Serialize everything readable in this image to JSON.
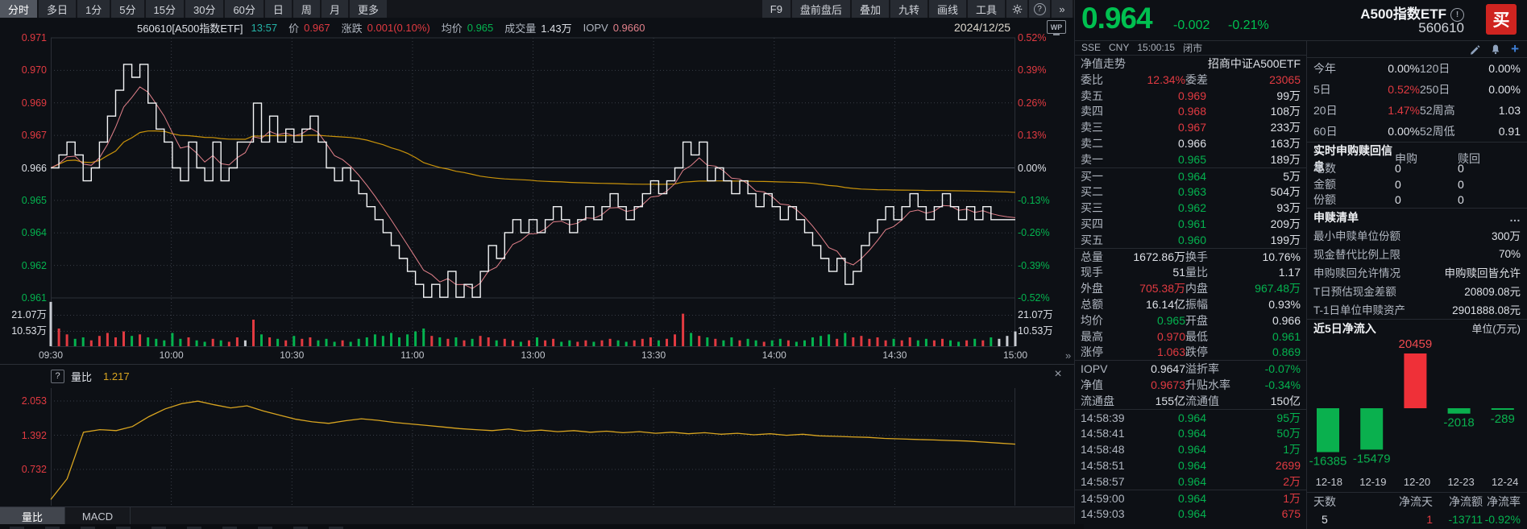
{
  "colors": {
    "up_red": "#e13a41",
    "down_green": "#04b34f",
    "flat_white": "#c9ccd3",
    "avg_yellow": "#c9930a",
    "price_line": "#f4f5f7",
    "iopv_pink": "#e2808a",
    "big_green": "#00c050",
    "buy_bg": "#cf2420"
  },
  "toolbar": {
    "periods": [
      "分时",
      "多日",
      "1分",
      "5分",
      "15分",
      "30分",
      "60分",
      "日",
      "周",
      "月",
      "更多"
    ],
    "active_period": "分时",
    "right_items": [
      "F9",
      "盘前盘后",
      "叠加",
      "九转",
      "画线",
      "工具"
    ],
    "help_icon": "?",
    "expand_icon": "»"
  },
  "info_bar": {
    "code_name": "560610[A500指数ETF]",
    "time": "13:57",
    "price_label": "价",
    "price": "0.967",
    "change_label": "涨跌",
    "change": "0.001(0.10%)",
    "avg_label": "均价",
    "avg": "0.965",
    "volume_label": "成交量",
    "volume": "1.43万",
    "iopv_label": "IOPV",
    "iopv": "0.9660",
    "date": "2024/12/25",
    "wp_badge": "WP"
  },
  "quote_header": {
    "price": "0.964",
    "change": "-0.002",
    "change_pct": "-0.21%",
    "name": "A500指数ETF",
    "code": "560610",
    "buy_button": "买",
    "info_mark": "!"
  },
  "sse_row": {
    "exchange": "SSE",
    "currency": "CNY",
    "time": "15:00:15",
    "status": "闭市"
  },
  "nav_row": {
    "label": "净值走势",
    "value": "招商中证A500ETF"
  },
  "weibi_row": {
    "label1": "委比",
    "value1": "12.34%",
    "label2": "委差",
    "value2": "23065"
  },
  "order_book": {
    "asks": [
      [
        "卖五",
        "0.969",
        "red",
        "99万"
      ],
      [
        "卖四",
        "0.968",
        "red",
        "108万"
      ],
      [
        "卖三",
        "0.967",
        "red",
        "233万"
      ],
      [
        "卖二",
        "0.966",
        "white",
        "163万"
      ],
      [
        "卖一",
        "0.965",
        "green",
        "189万"
      ]
    ],
    "bids": [
      [
        "买一",
        "0.964",
        "green",
        "5万"
      ],
      [
        "买二",
        "0.963",
        "green",
        "504万"
      ],
      [
        "买三",
        "0.962",
        "green",
        "93万"
      ],
      [
        "买四",
        "0.961",
        "green",
        "209万"
      ],
      [
        "买五",
        "0.960",
        "green",
        "199万"
      ]
    ]
  },
  "stats": [
    [
      "总量",
      "1672.86万",
      "white",
      "换手",
      "10.76%",
      "white"
    ],
    [
      "现手",
      "51",
      "white",
      "量比",
      "1.17",
      "white"
    ],
    [
      "外盘",
      "705.38万",
      "red",
      "内盘",
      "967.48万",
      "green"
    ],
    [
      "总额",
      "16.14亿",
      "white",
      "振幅",
      "0.93%",
      "white"
    ],
    [
      "均价",
      "0.965",
      "green",
      "开盘",
      "0.966",
      "white"
    ],
    [
      "最高",
      "0.970",
      "red",
      "最低",
      "0.961",
      "green"
    ],
    [
      "涨停",
      "1.063",
      "red",
      "跌停",
      "0.869",
      "green"
    ]
  ],
  "stats2": [
    [
      "IOPV",
      "0.9647",
      "white",
      "溢折率",
      "-0.07%",
      "green"
    ],
    [
      "净值",
      "0.9673",
      "red",
      "升贴水率",
      "-0.34%",
      "green"
    ],
    [
      "流通盘",
      "155亿",
      "white",
      "流通值",
      "150亿",
      "white"
    ]
  ],
  "ticks": [
    [
      "14:58:39",
      "0.964",
      "95万",
      "green"
    ],
    [
      "14:58:41",
      "0.964",
      "50万",
      "green"
    ],
    [
      "14:58:48",
      "0.964",
      "1万",
      "green"
    ],
    [
      "14:58:51",
      "0.964",
      "2699",
      "red"
    ],
    [
      "14:58:57",
      "0.964",
      "2万",
      "red"
    ],
    [
      "14:59:00",
      "0.964",
      "1万",
      "red"
    ],
    [
      "14:59:03",
      "0.964",
      "675",
      "red"
    ]
  ],
  "performance": [
    [
      "今年",
      "0.00%",
      "white",
      "120日",
      "0.00%",
      "white"
    ],
    [
      "5日",
      "0.52%",
      "red",
      "250日",
      "0.00%",
      "white"
    ],
    [
      "20日",
      "1.47%",
      "red",
      "52周高",
      "1.03",
      "white"
    ],
    [
      "60日",
      "0.00%",
      "white",
      "52周低",
      "0.91",
      "white"
    ]
  ],
  "realtime_section": {
    "title": "实时申购赎回信息",
    "col1": "申购",
    "col2": "赎回",
    "rows": [
      [
        "笔数",
        "0",
        "0"
      ],
      [
        "金额",
        "0",
        "0"
      ],
      [
        "份额",
        "0",
        "0"
      ]
    ]
  },
  "shenshu_section": {
    "title": "申赎清单",
    "more": "…",
    "rows": [
      [
        "最小申赎单位份额",
        "300万"
      ],
      [
        "现金替代比例上限",
        "70%"
      ],
      [
        "申购赎回允许情况",
        "申购赎回皆允许"
      ],
      [
        "T日预估现金差额",
        "20809.08元"
      ],
      [
        "T-1日单位申赎资产",
        "2901888.08元"
      ]
    ]
  },
  "netflow_footer": {
    "headers": [
      "天数",
      "净流天",
      "净流额",
      "净流率"
    ],
    "values": [
      "5",
      "1",
      "-13711",
      "-0.92%"
    ],
    "value_colors": [
      "white",
      "red",
      "green",
      "green"
    ]
  },
  "subchart_legend": {
    "help": "?",
    "name": "量比",
    "value": "1.217"
  },
  "subchart_tabs": [
    "量比",
    "MACD"
  ],
  "active_subchart_tab": "量比",
  "close_icon": "×",
  "divider_handle": "»",
  "chart_data": [
    {
      "type": "line",
      "name": "分时走势",
      "x_ticks": [
        "09:30",
        "10:00",
        "10:30",
        "11:00",
        "13:00",
        "13:30",
        "14:00",
        "14:30",
        "15:00"
      ],
      "x_tick_fractions": [
        0,
        0.125,
        0.25,
        0.375,
        0.5,
        0.625,
        0.75,
        0.875,
        1
      ],
      "y_left_labels": [
        "0.971",
        "0.970",
        "0.969",
        "0.967",
        "0.966",
        "0.965",
        "0.964",
        "0.962",
        "0.961"
      ],
      "y_right_labels": [
        "0.52%",
        "0.39%",
        "0.26%",
        "0.13%",
        "0.00%",
        "-0.13%",
        "-0.26%",
        "-0.39%",
        "-0.52%"
      ],
      "y_colors": [
        "red",
        "red",
        "red",
        "red",
        "white",
        "green",
        "green",
        "green",
        "green"
      ],
      "base_price": 0.966,
      "y_range": [
        0.960976,
        0.971024
      ],
      "series": {
        "price": [
          0.966,
          0.9665,
          0.967,
          0.9665,
          0.9655,
          0.966,
          0.967,
          0.968,
          0.969,
          0.97,
          0.9695,
          0.97,
          0.9685,
          0.9675,
          0.967,
          0.966,
          0.9655,
          0.967,
          0.966,
          0.9655,
          0.967,
          0.9655,
          0.966,
          0.967,
          0.967,
          0.9685,
          0.967,
          0.968,
          0.967,
          0.9675,
          0.967,
          0.9675,
          0.968,
          0.967,
          0.966,
          0.9655,
          0.966,
          0.9655,
          0.965,
          0.9645,
          0.964,
          0.9635,
          0.963,
          0.9625,
          0.962,
          0.9615,
          0.961,
          0.9615,
          0.961,
          0.962,
          0.961,
          0.9615,
          0.961,
          0.962,
          0.963,
          0.9625,
          0.9635,
          0.964,
          0.9635,
          0.964,
          0.9635,
          0.964,
          0.9645,
          0.964,
          0.9635,
          0.964,
          0.9645,
          0.964,
          0.9645,
          0.965,
          0.9645,
          0.964,
          0.9645,
          0.965,
          0.9655,
          0.965,
          0.9655,
          0.966,
          0.967,
          0.9665,
          0.967,
          0.9655,
          0.966,
          0.9655,
          0.965,
          0.9655,
          0.965,
          0.9645,
          0.965,
          0.9645,
          0.964,
          0.9645,
          0.964,
          0.9635,
          0.963,
          0.9625,
          0.962,
          0.9625,
          0.9615,
          0.962,
          0.963,
          0.9635,
          0.964,
          0.9645,
          0.964,
          0.9645,
          0.965,
          0.9645,
          0.964,
          0.9645,
          0.965,
          0.9645,
          0.964,
          0.9645,
          0.964,
          0.9645,
          0.964,
          0.964,
          0.964,
          0.964
        ]
      },
      "volume": {
        "grid_labels": [
          "21.07万",
          "10.53万"
        ],
        "max_wan": 31.6,
        "values": [
          30,
          12,
          8,
          5,
          6,
          4,
          7,
          9,
          6,
          10,
          7,
          8,
          6,
          5,
          4,
          9,
          5,
          6,
          4,
          3,
          5,
          4,
          3,
          6,
          4,
          18,
          8,
          6,
          5,
          4,
          7,
          5,
          6,
          4,
          5,
          3,
          4,
          3,
          5,
          6,
          8,
          7,
          9,
          6,
          8,
          10,
          12,
          7,
          6,
          5,
          6,
          4,
          5,
          7,
          6,
          4,
          5,
          4,
          3,
          4,
          6,
          4,
          5,
          3,
          4,
          3,
          4,
          3,
          4,
          5,
          4,
          3,
          4,
          5,
          6,
          4,
          5,
          8,
          22,
          9,
          7,
          6,
          5,
          4,
          6,
          4,
          5,
          4,
          3,
          4,
          5,
          4,
          3,
          4,
          6,
          7,
          8,
          5,
          9,
          6,
          7,
          5,
          6,
          4,
          5,
          4,
          6,
          4,
          5,
          4,
          5,
          4,
          3,
          4,
          5,
          4,
          6,
          5,
          7,
          10
        ]
      }
    },
    {
      "type": "line",
      "name": "量比",
      "current": "1.217",
      "y_labels": [
        "2.053",
        "1.392",
        "0.732"
      ],
      "values": [
        0.15,
        0.55,
        1.45,
        1.5,
        1.48,
        1.56,
        1.75,
        1.9,
        2.0,
        2.05,
        1.98,
        1.92,
        1.96,
        1.86,
        1.78,
        1.7,
        1.65,
        1.62,
        1.67,
        1.71,
        1.68,
        1.64,
        1.61,
        1.58,
        1.55,
        1.52,
        1.5,
        1.48,
        1.51,
        1.47,
        1.49,
        1.46,
        1.48,
        1.45,
        1.47,
        1.44,
        1.46,
        1.43,
        1.45,
        1.42,
        1.44,
        1.41,
        1.43,
        1.4,
        1.42,
        1.39,
        1.41,
        1.38,
        1.37,
        1.36,
        1.35,
        1.33,
        1.32,
        1.31,
        1.3,
        1.29,
        1.28,
        1.26,
        1.24,
        1.22
      ]
    },
    {
      "type": "bar",
      "name": "近5日净流入",
      "unit": "单位(万元)",
      "categories": [
        "12-18",
        "12-19",
        "12-20",
        "12-23",
        "12-24"
      ],
      "values": [
        -16385,
        -15479,
        20459,
        -2018,
        -289
      ],
      "pos_color": "#ef3038",
      "neg_color": "#0ab04e"
    }
  ]
}
